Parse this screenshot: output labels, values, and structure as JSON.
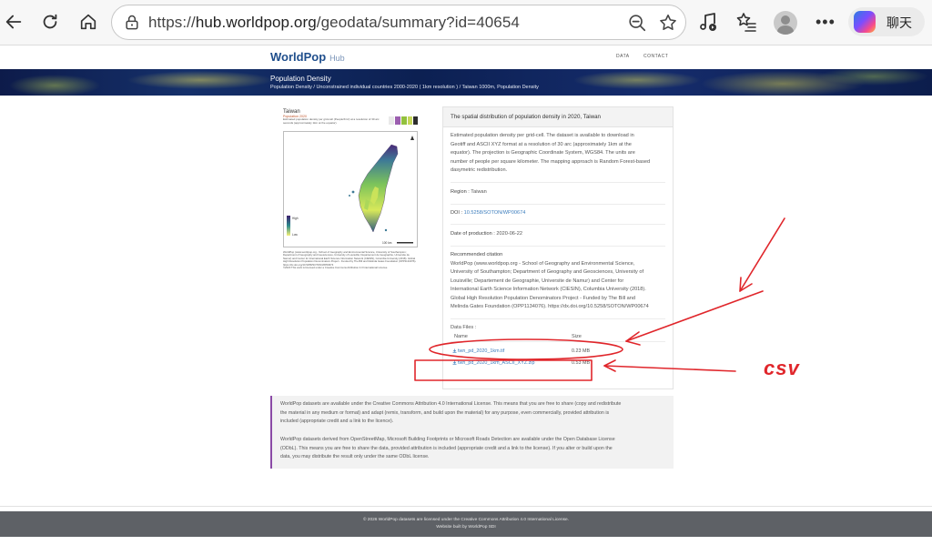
{
  "browser": {
    "url_scheme": "https://",
    "url_host": "hub.worldpop.org",
    "url_path": "/geodata/summary?id=40654",
    "copilot_label": "聊天",
    "more_label": "•••"
  },
  "site": {
    "logo_text": "WorldPop",
    "logo_suffix": "Hub",
    "nav": [
      "DATA",
      "CONTACT"
    ]
  },
  "banner": {
    "title": "Population Density",
    "breadcrumb": "Population Density / Unconstrained individual countries 2000-2020 ( 1km resolution ) / Taiwan 1000m, Population Density"
  },
  "map": {
    "title": "Taiwan",
    "subtitle": "Population 2020",
    "description": "Estimated population density per grid-cell (People/Km²) at a resolution of 30 arc seconds (approximately 1km at the equator).",
    "legend_high": "High",
    "legend_low": "Low",
    "scale": "100 km",
    "caption": "WorldPop (www.worldpop.org - School of Geography and Environmental Science, University of Southampton; Department of Geography and Geosciences, University of Louisville; Departement de Geographie, Universite de Namur) and Center for International Earth Science Information Network (CIESIN), Columbia University (2018). Global High Resolution Population Denominators Project - Funded by The Bill and Melinda Gates Foundation (OPP1134076). https://dx.doi.org/10.5258/SOTON/WP00674",
    "license_note": "©2020 This work is licensed under a Creative Commons Attribution 4.0 International License."
  },
  "panel": {
    "heading": "The spatial distribution of population density in 2020, Taiwan",
    "description_lines": [
      "Estimated population density per grid-cell. The dataset is available to download in",
      "Geotiff and ASCII XYZ format at a resolution of 30 arc (approximately 1km at the",
      "equator). The projection is Geographic Coordinate System, WGS84. The units are",
      "number of people per square kilometer. The mapping approach is Random Forest-based",
      "dasymetric redistribution."
    ],
    "region_label": "Region :",
    "region_value": "Taiwan",
    "doi_label": "DOI :",
    "doi_value": "10.5258/SOTON/WP00674",
    "date_label": "Date of production :",
    "date_value": "2020-06-22",
    "citation_label": "Recommended citation",
    "citation_lines": [
      "WorldPop (www.worldpop.org - School of Geography and Environmental Science,",
      "University of Southampton; Department of Geography and Geosciences, University of",
      "Louisville; Departement de Geographie, Universite de Namur) and Center for",
      "International Earth Science Information Network (CIESIN), Columbia University (2018).",
      "Global High Resolution Population Denominators Project - Funded by The Bill and",
      "Melinda Gates Foundation (OPP1134076). https://dx.doi.org/10.5258/SOTON/WP00674"
    ],
    "files_label": "Data Files :",
    "col_name": "Name",
    "col_size": "Size",
    "files": [
      {
        "name": "twn_pd_2020_1km.tif",
        "size": "0.23 MB"
      },
      {
        "name": "twn_pd_2020_1km_ASCII_XYZ.zip",
        "size": "0.53 MB"
      }
    ]
  },
  "license": {
    "para1_lines": [
      "WorldPop datasets are available under the Creative Commons Attribution 4.0 International License. This means that you are free to share (copy and redistribute",
      "the material in any medium or format) and adapt (remix, transform, and build upon the material) for any purpose, even commercially, provided attribution is",
      "included (appropriate credit and a link to the licence)."
    ],
    "para2_lines": [
      "WorldPop datasets derived from OpenStreetMap, Microsoft Building Footprints or Microsoft Roads Detection are available under the Open Database License",
      "(ODbL). This means you are free to share the data, provided attribution is included (appropriate credit and a link to the license). If you alter or build upon the",
      "data, you may distribute the result only under the same ODbL license."
    ]
  },
  "footer": {
    "line1": "© 2026 WorldPop datasets are licensed under the Creative Commons Attribution 4.0 International License.",
    "line2": "Website built by WorldPop SDI"
  },
  "annotation": {
    "label": "csv",
    "color": "#e0262b"
  }
}
